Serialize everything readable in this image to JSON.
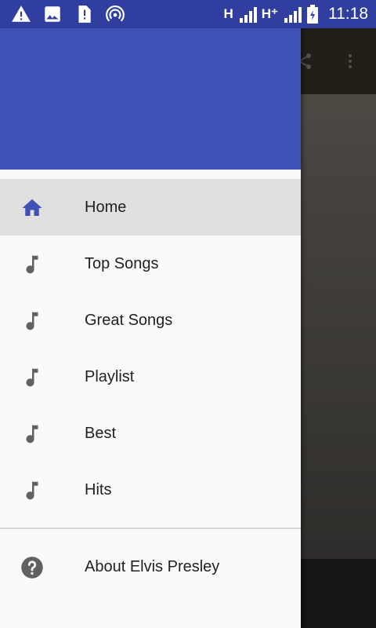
{
  "status_bar": {
    "network_1": "H",
    "network_2": "H⁺",
    "time": "11:18",
    "icons": [
      "warning-icon",
      "image-icon",
      "sim-alert-icon",
      "hotspot-icon",
      "signal-icon",
      "battery-icon"
    ]
  },
  "colors": {
    "status_bar": "#303F9F",
    "drawer_header": "#3F51B5",
    "active_item_bg": "#E0E0E0",
    "active_icon": "#3F51B5",
    "inactive_icon": "#616161"
  },
  "drawer": {
    "menu": [
      {
        "label": "Home",
        "icon": "home-icon",
        "active": true
      },
      {
        "label": "Top Songs",
        "icon": "music-note-icon",
        "active": false
      },
      {
        "label": "Great Songs",
        "icon": "music-note-icon",
        "active": false
      },
      {
        "label": "Playlist",
        "icon": "music-note-icon",
        "active": false
      },
      {
        "label": "Best",
        "icon": "music-note-icon",
        "active": false
      },
      {
        "label": "Hits",
        "icon": "music-note-icon",
        "active": false
      }
    ],
    "footer_item": {
      "label": "About Elvis Presley",
      "icon": "help-icon"
    }
  },
  "app_toolbar": {
    "icons": [
      "share-icon",
      "more-vert-icon"
    ]
  }
}
